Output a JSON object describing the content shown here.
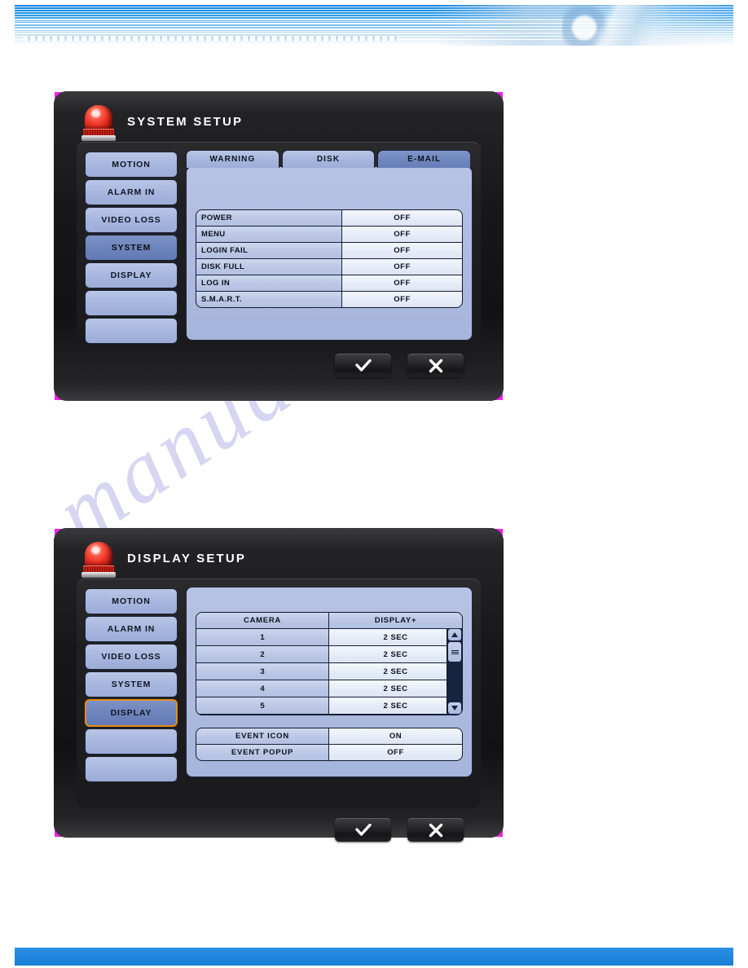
{
  "page": {
    "watermark_text": "manualshive.com",
    "banner_accent": "#1183e0",
    "footer_accent": "#2a90e4"
  },
  "windows": [
    {
      "id": "system",
      "title": "SYSTEM SETUP",
      "icon": "siren-beacon-icon",
      "sidebar": [
        {
          "label": "MOTION",
          "state": "normal"
        },
        {
          "label": "ALARM IN",
          "state": "normal"
        },
        {
          "label": "VIDEO LOSS",
          "state": "normal"
        },
        {
          "label": "SYSTEM",
          "state": "selected"
        },
        {
          "label": "DISPLAY",
          "state": "normal"
        },
        {
          "label": "",
          "state": "empty"
        },
        {
          "label": "",
          "state": "empty"
        }
      ],
      "tabs": [
        {
          "label": "WARNING",
          "active": false
        },
        {
          "label": "DISK",
          "active": false
        },
        {
          "label": "E-MAIL",
          "active": true
        }
      ],
      "settings_rows": [
        {
          "label": "POWER",
          "value": "OFF"
        },
        {
          "label": "MENU",
          "value": "OFF"
        },
        {
          "label": "LOGIN FAIL",
          "value": "OFF"
        },
        {
          "label": "DISK FULL",
          "value": "OFF"
        },
        {
          "label": "LOG IN",
          "value": "OFF"
        },
        {
          "label": "S.M.A.R.T.",
          "value": "OFF"
        }
      ],
      "buttons": [
        {
          "name": "confirm",
          "icon": "check-icon"
        },
        {
          "name": "cancel",
          "icon": "close-icon"
        }
      ]
    },
    {
      "id": "display",
      "title": "DISPLAY SETUP",
      "icon": "siren-beacon-icon",
      "sidebar": [
        {
          "label": "MOTION",
          "state": "normal"
        },
        {
          "label": "ALARM IN",
          "state": "normal"
        },
        {
          "label": "VIDEO LOSS",
          "state": "normal"
        },
        {
          "label": "SYSTEM",
          "state": "normal"
        },
        {
          "label": "DISPLAY",
          "state": "focused"
        },
        {
          "label": "",
          "state": "empty"
        },
        {
          "label": "",
          "state": "empty"
        }
      ],
      "camera_table": {
        "headers": [
          "CAMERA",
          "DISPLAY+"
        ],
        "rows": [
          {
            "camera": "1",
            "display": "2 SEC"
          },
          {
            "camera": "2",
            "display": "2 SEC"
          },
          {
            "camera": "3",
            "display": "2 SEC"
          },
          {
            "camera": "4",
            "display": "2 SEC"
          },
          {
            "camera": "5",
            "display": "2 SEC"
          }
        ],
        "scrollbar": {
          "up_icon": "scroll-up-arrow-icon",
          "down_icon": "scroll-down-arrow-icon",
          "thumb": "scrollbar-thumb"
        }
      },
      "event_rows": [
        {
          "label": "EVENT ICON",
          "value": "ON"
        },
        {
          "label": "EVENT POPUP",
          "value": "OFF"
        }
      ],
      "buttons": [
        {
          "name": "confirm",
          "icon": "check-icon"
        },
        {
          "name": "cancel",
          "icon": "close-icon"
        }
      ]
    }
  ]
}
